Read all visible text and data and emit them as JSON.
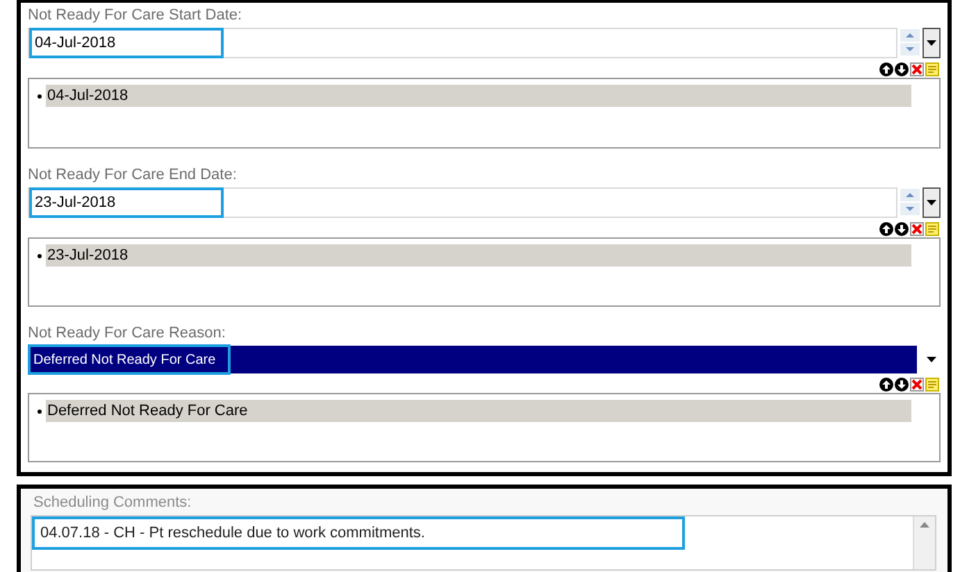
{
  "fields": [
    {
      "kind": "date",
      "label": "Not Ready For Care Start Date:",
      "value": "04-Jul-2018",
      "items": [
        "04-Jul-2018"
      ]
    },
    {
      "kind": "date",
      "label": "Not Ready For Care End Date:",
      "value": "23-Jul-2018",
      "items": [
        "23-Jul-2018"
      ]
    },
    {
      "kind": "dropdown",
      "label": "Not Ready For Care Reason:",
      "value": "Deferred Not Ready For Care",
      "items": [
        "Deferred Not Ready For Care"
      ]
    }
  ],
  "comments": {
    "label": "Scheduling Comments:",
    "value": "04.07.18 - CH - Pt reschedule due to work commitments."
  }
}
